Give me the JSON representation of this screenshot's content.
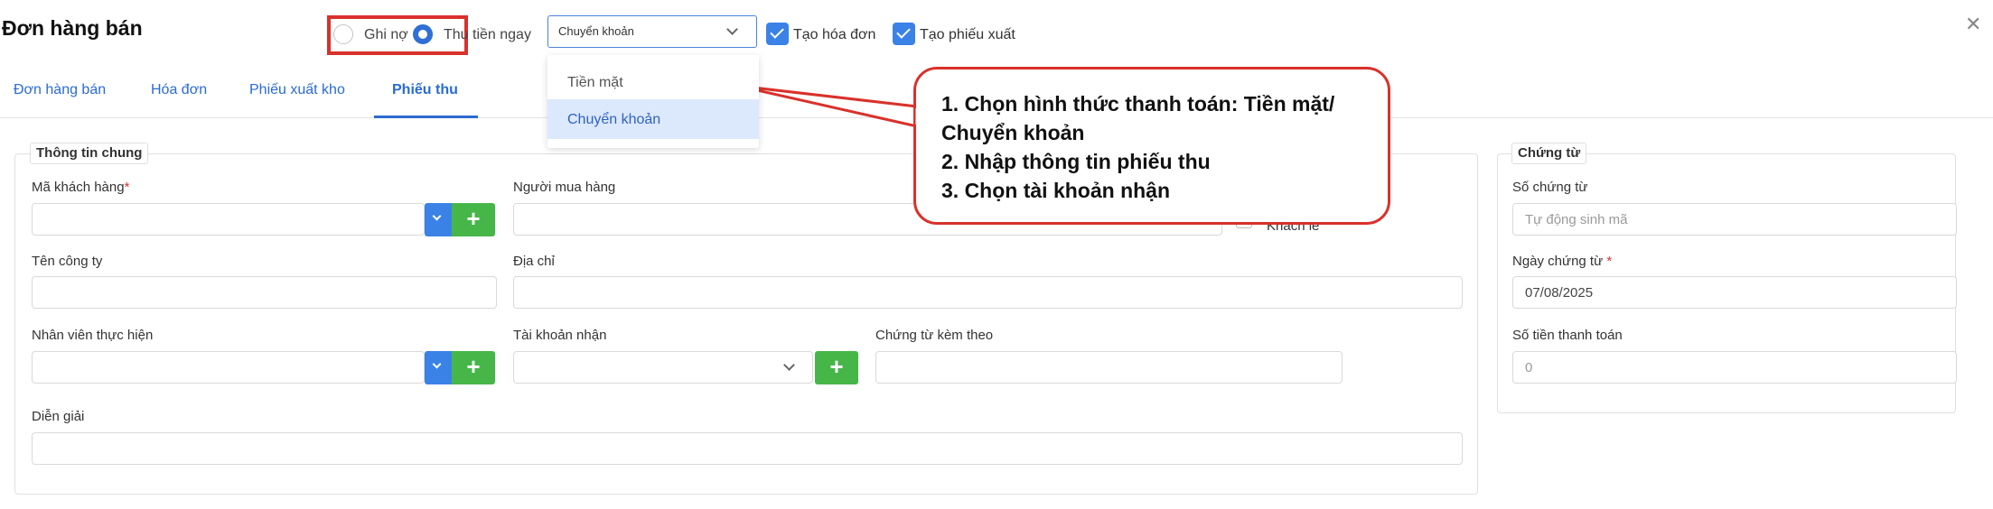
{
  "header": {
    "title": "Đơn hàng bán",
    "close_icon": "close-icon"
  },
  "payment_mode": {
    "options": [
      {
        "label": "Ghi nợ",
        "selected": false
      },
      {
        "label": "Thu tiền ngay",
        "selected": true
      }
    ],
    "highlight_color": "#d9312b"
  },
  "payment_method": {
    "value": "Chuyển khoản",
    "options": [
      "Tiền mặt",
      "Chuyển khoản"
    ],
    "selected_index": 1
  },
  "checkboxes": [
    {
      "label": "Tạo hóa đơn",
      "checked": true
    },
    {
      "label": "Tạo phiếu xuất",
      "checked": true
    }
  ],
  "tabs": [
    {
      "label": "Đơn hàng bán",
      "active": false
    },
    {
      "label": "Hóa đơn",
      "active": false
    },
    {
      "label": "Phiếu xuất kho",
      "active": false
    },
    {
      "label": "Phiếu thu",
      "active": true
    }
  ],
  "general": {
    "legend": "Thông tin chung",
    "customer_code_label": "Mã khách hàng",
    "required_mark": "*",
    "buyer_label": "Người mua hàng",
    "walkin_label": "Khách lẻ",
    "company_label": "Tên công ty",
    "address_label": "Địa chỉ",
    "staff_label": "Nhân viên thực hiện",
    "account_label": "Tài khoản nhận",
    "attached_docs_label": "Chứng từ kèm theo",
    "description_label": "Diễn giải"
  },
  "voucher": {
    "legend": "Chứng từ",
    "number_label": "Số chứng từ",
    "number_placeholder": "Tự động sinh mã",
    "date_label": "Ngày chứng từ",
    "required_mark": "*",
    "date_value": "07/08/2025",
    "amount_label": "Số tiền thanh toán",
    "amount_value": "0"
  },
  "annotation": {
    "lines": [
      "1. Chọn hình thức thanh toán: Tiền mặt/ Chuyển khoản",
      "2. Nhập thông tin phiếu thu",
      "3. Chọn tài khoản nhận"
    ],
    "border_color": "#d9312b"
  },
  "colors": {
    "accent_blue": "#3a82e6",
    "add_green": "#46b649",
    "tab_blue": "#2a6bd1"
  }
}
